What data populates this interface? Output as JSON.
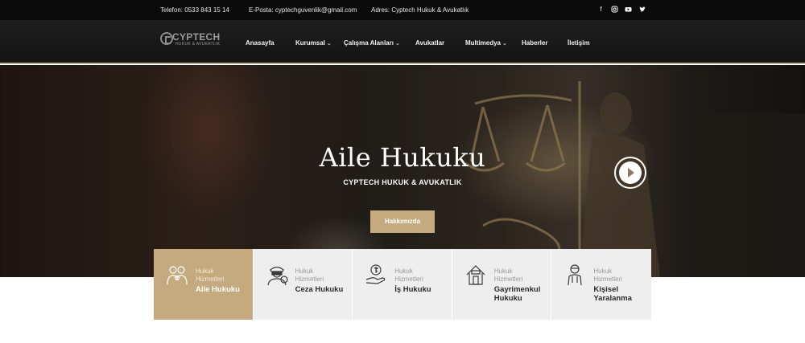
{
  "topbar": {
    "phone": "Telefon: 0533 843 15 14",
    "email": "E-Posta: cyptechguvenlik@gmail.com",
    "address": "Adres: Cyptech Hukuk & Avukatlık",
    "social": [
      "facebook-icon",
      "instagram-icon",
      "youtube-icon",
      "twitter-icon"
    ]
  },
  "logo": {
    "name": "CYPTECH",
    "tagline": "HUKUK & AVUKATLIK"
  },
  "nav": {
    "home": "Anasayfa",
    "corporate": "Kurumsal",
    "practice": "Çalışma Alanları",
    "lawyers": "Avukatlar",
    "media": "Multimedya",
    "news": "Haberler",
    "contact": "İletişim"
  },
  "hero": {
    "title": "Aile Hukuku",
    "subtitle": "CYPTECH HUKUK & AVUKATLIK",
    "button": "Hakkımızda"
  },
  "cards": [
    {
      "kicker": "Hukuk Hizmetleri",
      "title": "Aile Hukuku",
      "icon": "family-icon",
      "active": true
    },
    {
      "kicker": "Hukuk Hizmetleri",
      "title": "Ceza Hukuku",
      "icon": "thief-icon",
      "active": false
    },
    {
      "kicker": "Hukuk Hizmetleri",
      "title": "İş Hukuku",
      "icon": "money-hand-icon",
      "active": false
    },
    {
      "kicker": "Hukuk Hizmetleri",
      "title": "Gayrimenkul Hukuku",
      "icon": "house-icon",
      "active": false
    },
    {
      "kicker": "Hukuk Hizmetleri",
      "title": "Kişisel Yaralanma",
      "icon": "injured-person-icon",
      "active": false
    }
  ],
  "colors": {
    "accent": "#c4aa7e",
    "topbar": "#0b0b0b",
    "navbar": "#1a1a1a",
    "card": "#eeeeee"
  }
}
